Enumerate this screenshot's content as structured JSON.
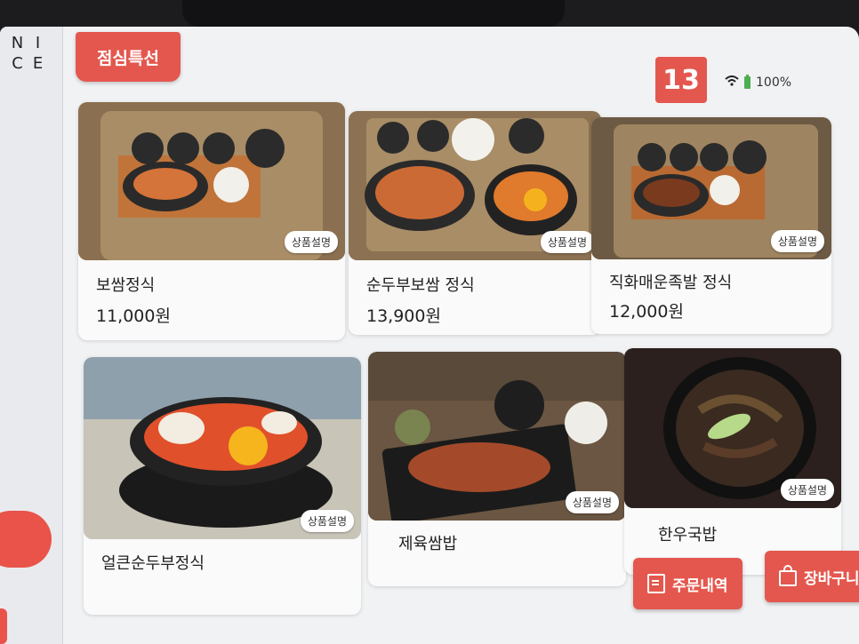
{
  "header": {
    "category_tab": "점심특선",
    "table_number": "13",
    "battery": "100%"
  },
  "logo": [
    "N",
    "I",
    "C",
    "E"
  ],
  "menu_items": [
    {
      "name": "보쌈정식",
      "price": "11,000원",
      "desc_button": "상품설명"
    },
    {
      "name": "순두부보쌈 정식",
      "price": "13,900원",
      "desc_button": "상품설명"
    },
    {
      "name": "직화매운족발 정식",
      "price": "12,000원",
      "desc_button": "상품설명"
    },
    {
      "name": "얼큰순두부정식",
      "price": "",
      "desc_button": "상품설명"
    },
    {
      "name": "제육쌈밥",
      "price": "",
      "desc_button": "상품설명"
    },
    {
      "name": "한우국밥",
      "price": "",
      "desc_button": "상품설명"
    }
  ],
  "footer": {
    "order_history": "주문내역",
    "cart": "장바구니"
  },
  "colors": {
    "accent": "#e4574e",
    "screen_bg": "#f1f2f4"
  }
}
